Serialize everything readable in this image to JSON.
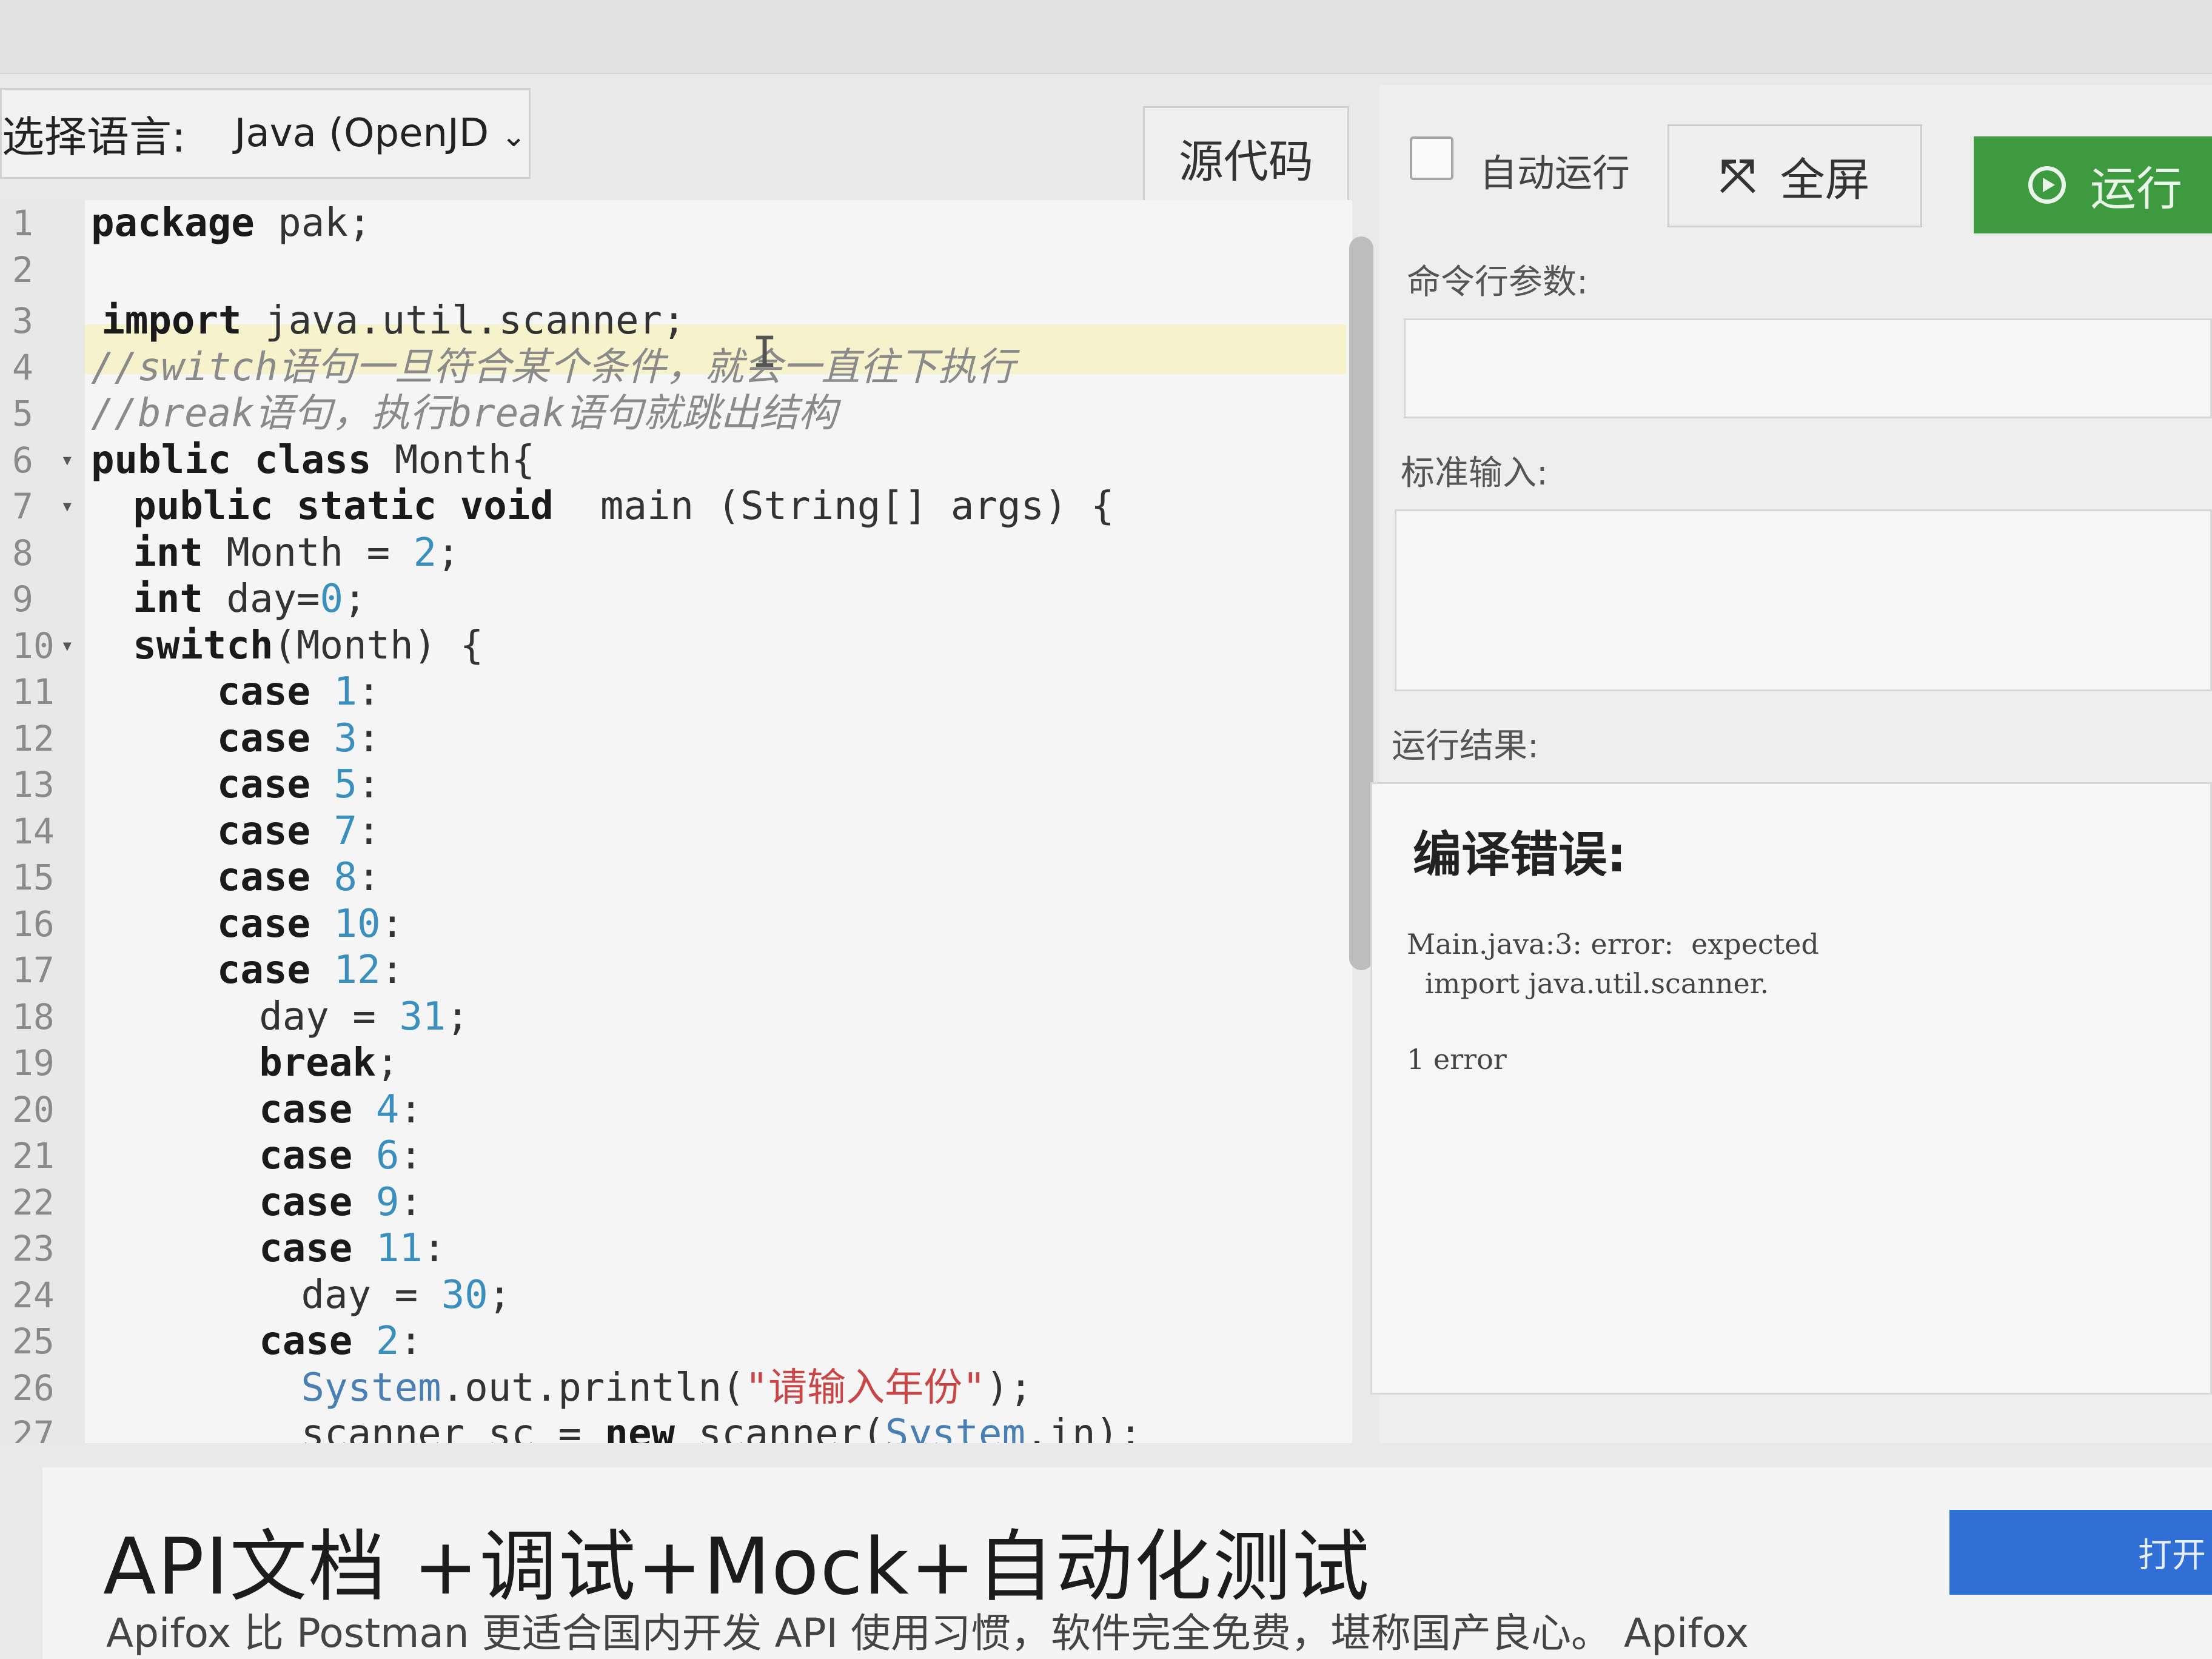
{
  "toolbar": {
    "language_label": "选择语言:",
    "language_value": "Java (OpenJD",
    "source_button": "源代码",
    "auto_run_label": "自动运行",
    "fullscreen_button": "全屏",
    "run_button": "运行"
  },
  "editor": {
    "lines": [
      {
        "n": "1",
        "fold": "",
        "indent": 0,
        "tokens": [
          {
            "t": "package",
            "c": "kw"
          },
          {
            "t": " pak;",
            "c": ""
          }
        ]
      },
      {
        "n": "2",
        "fold": "",
        "indent": 0,
        "tokens": []
      },
      {
        "n": "3",
        "fold": "",
        "indent": 1,
        "tokens": [
          {
            "t": "import",
            "c": "kw"
          },
          {
            "t": " java.util.scanner;",
            "c": ""
          }
        ]
      },
      {
        "n": "4",
        "fold": "",
        "indent": 0,
        "tokens": [
          {
            "t": "//switch语句一旦符合某个条件，就会一直往下执行",
            "c": "cm"
          }
        ]
      },
      {
        "n": "5",
        "fold": "",
        "indent": 0,
        "tokens": [
          {
            "t": "//break语句，执行break语句就跳出结构",
            "c": "cm"
          }
        ]
      },
      {
        "n": "6",
        "fold": "▾",
        "indent": 0,
        "tokens": [
          {
            "t": "public class",
            "c": "kw"
          },
          {
            "t": " Month{",
            "c": ""
          }
        ]
      },
      {
        "n": "7",
        "fold": "▾",
        "indent": 4,
        "tokens": [
          {
            "t": "public static void",
            "c": "kw"
          },
          {
            "t": "  main (String[] args) {",
            "c": ""
          }
        ]
      },
      {
        "n": "8",
        "fold": "",
        "indent": 4,
        "tokens": [
          {
            "t": "int",
            "c": "kw"
          },
          {
            "t": " Month = ",
            "c": ""
          },
          {
            "t": "2",
            "c": "num"
          },
          {
            "t": ";",
            "c": ""
          }
        ]
      },
      {
        "n": "9",
        "fold": "",
        "indent": 4,
        "tokens": [
          {
            "t": "int",
            "c": "kw"
          },
          {
            "t": " day=",
            "c": ""
          },
          {
            "t": "0",
            "c": "num"
          },
          {
            "t": ";",
            "c": ""
          }
        ]
      },
      {
        "n": "10",
        "fold": "▾",
        "indent": 4,
        "tokens": [
          {
            "t": "switch",
            "c": "kw"
          },
          {
            "t": "(Month) {",
            "c": ""
          }
        ]
      },
      {
        "n": "11",
        "fold": "",
        "indent": 12,
        "tokens": [
          {
            "t": "case",
            "c": "kw"
          },
          {
            "t": " ",
            "c": ""
          },
          {
            "t": "1",
            "c": "num"
          },
          {
            "t": ":",
            "c": ""
          }
        ]
      },
      {
        "n": "12",
        "fold": "",
        "indent": 12,
        "tokens": [
          {
            "t": "case",
            "c": "kw"
          },
          {
            "t": " ",
            "c": ""
          },
          {
            "t": "3",
            "c": "num"
          },
          {
            "t": ":",
            "c": ""
          }
        ]
      },
      {
        "n": "13",
        "fold": "",
        "indent": 12,
        "tokens": [
          {
            "t": "case",
            "c": "kw"
          },
          {
            "t": " ",
            "c": ""
          },
          {
            "t": "5",
            "c": "num"
          },
          {
            "t": ":",
            "c": ""
          }
        ]
      },
      {
        "n": "14",
        "fold": "",
        "indent": 12,
        "tokens": [
          {
            "t": "case",
            "c": "kw"
          },
          {
            "t": " ",
            "c": ""
          },
          {
            "t": "7",
            "c": "num"
          },
          {
            "t": ":",
            "c": ""
          }
        ]
      },
      {
        "n": "15",
        "fold": "",
        "indent": 12,
        "tokens": [
          {
            "t": "case",
            "c": "kw"
          },
          {
            "t": " ",
            "c": ""
          },
          {
            "t": "8",
            "c": "num"
          },
          {
            "t": ":",
            "c": ""
          }
        ]
      },
      {
        "n": "16",
        "fold": "",
        "indent": 12,
        "tokens": [
          {
            "t": "case",
            "c": "kw"
          },
          {
            "t": " ",
            "c": ""
          },
          {
            "t": "10",
            "c": "num"
          },
          {
            "t": ":",
            "c": ""
          }
        ]
      },
      {
        "n": "17",
        "fold": "",
        "indent": 12,
        "tokens": [
          {
            "t": "case",
            "c": "kw"
          },
          {
            "t": " ",
            "c": ""
          },
          {
            "t": "12",
            "c": "num"
          },
          {
            "t": ":",
            "c": ""
          }
        ]
      },
      {
        "n": "18",
        "fold": "",
        "indent": 16,
        "tokens": [
          {
            "t": "day = ",
            "c": ""
          },
          {
            "t": "31",
            "c": "num"
          },
          {
            "t": ";",
            "c": ""
          }
        ]
      },
      {
        "n": "19",
        "fold": "",
        "indent": 16,
        "tokens": [
          {
            "t": "break",
            "c": "kw"
          },
          {
            "t": ";",
            "c": ""
          }
        ]
      },
      {
        "n": "20",
        "fold": "",
        "indent": 16,
        "tokens": [
          {
            "t": "case",
            "c": "kw"
          },
          {
            "t": " ",
            "c": ""
          },
          {
            "t": "4",
            "c": "num"
          },
          {
            "t": ":",
            "c": ""
          }
        ]
      },
      {
        "n": "21",
        "fold": "",
        "indent": 16,
        "tokens": [
          {
            "t": "case",
            "c": "kw"
          },
          {
            "t": " ",
            "c": ""
          },
          {
            "t": "6",
            "c": "num"
          },
          {
            "t": ":",
            "c": ""
          }
        ]
      },
      {
        "n": "22",
        "fold": "",
        "indent": 16,
        "tokens": [
          {
            "t": "case",
            "c": "kw"
          },
          {
            "t": " ",
            "c": ""
          },
          {
            "t": "9",
            "c": "num"
          },
          {
            "t": ":",
            "c": ""
          }
        ]
      },
      {
        "n": "23",
        "fold": "",
        "indent": 16,
        "tokens": [
          {
            "t": "case",
            "c": "kw"
          },
          {
            "t": " ",
            "c": ""
          },
          {
            "t": "11",
            "c": "num"
          },
          {
            "t": ":",
            "c": ""
          }
        ]
      },
      {
        "n": "24",
        "fold": "",
        "indent": 20,
        "tokens": [
          {
            "t": "day = ",
            "c": ""
          },
          {
            "t": "30",
            "c": "num"
          },
          {
            "t": ";",
            "c": ""
          }
        ]
      },
      {
        "n": "25",
        "fold": "",
        "indent": 16,
        "tokens": [
          {
            "t": "case",
            "c": "kw"
          },
          {
            "t": " ",
            "c": ""
          },
          {
            "t": "2",
            "c": "num"
          },
          {
            "t": ":",
            "c": ""
          }
        ]
      },
      {
        "n": "26",
        "fold": "",
        "indent": 20,
        "tokens": [
          {
            "t": "System",
            "c": "sys"
          },
          {
            "t": ".out.println(",
            "c": ""
          },
          {
            "t": "\"请输入年份\"",
            "c": "str"
          },
          {
            "t": ");",
            "c": ""
          }
        ]
      },
      {
        "n": "27",
        "fold": "",
        "indent": 20,
        "tokens": [
          {
            "t": "scanner sc = ",
            "c": ""
          },
          {
            "t": "new",
            "c": "kw"
          },
          {
            "t": " scanner(",
            "c": ""
          },
          {
            "t": "System",
            "c": "sys"
          },
          {
            "t": ".in);",
            "c": ""
          }
        ]
      }
    ]
  },
  "right_panel": {
    "args_label": "命令行参数:",
    "stdin_label": "标准输入:",
    "result_label": "运行结果:",
    "error_title": "编译错误:",
    "error_line1": "Main.java:3: error:  expected",
    "error_line2": "import java.util.scanner.",
    "error_count": "1 error"
  },
  "ad": {
    "title": "API文档 +调试+Mock+自动化测试",
    "subtitle": "Apifox 比 Postman 更适合国内开发 API 使用习惯，软件完全免费，堪称国产良心。 Apifox",
    "button": "打开"
  },
  "icons": {
    "chevron": "chevron-down-icon",
    "fullscreen": "fullscreen-icon",
    "run": "play-circle-icon"
  },
  "colors": {
    "run_button": "#3d9a3e",
    "ad_button": "#2f6fd6",
    "active_line": "#f6f3cc"
  }
}
